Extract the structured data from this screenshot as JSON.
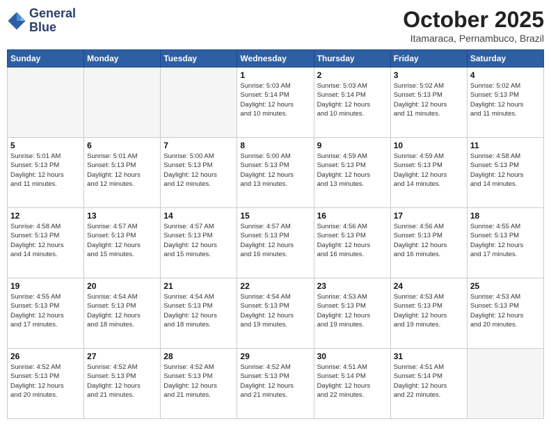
{
  "logo": {
    "line1": "General",
    "line2": "Blue"
  },
  "title": "October 2025",
  "location": "Itamaraca, Pernambuco, Brazil",
  "days_header": [
    "Sunday",
    "Monday",
    "Tuesday",
    "Wednesday",
    "Thursday",
    "Friday",
    "Saturday"
  ],
  "weeks": [
    [
      {
        "day": "",
        "info": ""
      },
      {
        "day": "",
        "info": ""
      },
      {
        "day": "",
        "info": ""
      },
      {
        "day": "1",
        "info": "Sunrise: 5:03 AM\nSunset: 5:14 PM\nDaylight: 12 hours\nand 10 minutes."
      },
      {
        "day": "2",
        "info": "Sunrise: 5:03 AM\nSunset: 5:14 PM\nDaylight: 12 hours\nand 10 minutes."
      },
      {
        "day": "3",
        "info": "Sunrise: 5:02 AM\nSunset: 5:13 PM\nDaylight: 12 hours\nand 11 minutes."
      },
      {
        "day": "4",
        "info": "Sunrise: 5:02 AM\nSunset: 5:13 PM\nDaylight: 12 hours\nand 11 minutes."
      }
    ],
    [
      {
        "day": "5",
        "info": "Sunrise: 5:01 AM\nSunset: 5:13 PM\nDaylight: 12 hours\nand 11 minutes."
      },
      {
        "day": "6",
        "info": "Sunrise: 5:01 AM\nSunset: 5:13 PM\nDaylight: 12 hours\nand 12 minutes."
      },
      {
        "day": "7",
        "info": "Sunrise: 5:00 AM\nSunset: 5:13 PM\nDaylight: 12 hours\nand 12 minutes."
      },
      {
        "day": "8",
        "info": "Sunrise: 5:00 AM\nSunset: 5:13 PM\nDaylight: 12 hours\nand 13 minutes."
      },
      {
        "day": "9",
        "info": "Sunrise: 4:59 AM\nSunset: 5:13 PM\nDaylight: 12 hours\nand 13 minutes."
      },
      {
        "day": "10",
        "info": "Sunrise: 4:59 AM\nSunset: 5:13 PM\nDaylight: 12 hours\nand 14 minutes."
      },
      {
        "day": "11",
        "info": "Sunrise: 4:58 AM\nSunset: 5:13 PM\nDaylight: 12 hours\nand 14 minutes."
      }
    ],
    [
      {
        "day": "12",
        "info": "Sunrise: 4:58 AM\nSunset: 5:13 PM\nDaylight: 12 hours\nand 14 minutes."
      },
      {
        "day": "13",
        "info": "Sunrise: 4:57 AM\nSunset: 5:13 PM\nDaylight: 12 hours\nand 15 minutes."
      },
      {
        "day": "14",
        "info": "Sunrise: 4:57 AM\nSunset: 5:13 PM\nDaylight: 12 hours\nand 15 minutes."
      },
      {
        "day": "15",
        "info": "Sunrise: 4:57 AM\nSunset: 5:13 PM\nDaylight: 12 hours\nand 16 minutes."
      },
      {
        "day": "16",
        "info": "Sunrise: 4:56 AM\nSunset: 5:13 PM\nDaylight: 12 hours\nand 16 minutes."
      },
      {
        "day": "17",
        "info": "Sunrise: 4:56 AM\nSunset: 5:13 PM\nDaylight: 12 hours\nand 16 minutes."
      },
      {
        "day": "18",
        "info": "Sunrise: 4:55 AM\nSunset: 5:13 PM\nDaylight: 12 hours\nand 17 minutes."
      }
    ],
    [
      {
        "day": "19",
        "info": "Sunrise: 4:55 AM\nSunset: 5:13 PM\nDaylight: 12 hours\nand 17 minutes."
      },
      {
        "day": "20",
        "info": "Sunrise: 4:54 AM\nSunset: 5:13 PM\nDaylight: 12 hours\nand 18 minutes."
      },
      {
        "day": "21",
        "info": "Sunrise: 4:54 AM\nSunset: 5:13 PM\nDaylight: 12 hours\nand 18 minutes."
      },
      {
        "day": "22",
        "info": "Sunrise: 4:54 AM\nSunset: 5:13 PM\nDaylight: 12 hours\nand 19 minutes."
      },
      {
        "day": "23",
        "info": "Sunrise: 4:53 AM\nSunset: 5:13 PM\nDaylight: 12 hours\nand 19 minutes."
      },
      {
        "day": "24",
        "info": "Sunrise: 4:53 AM\nSunset: 5:13 PM\nDaylight: 12 hours\nand 19 minutes."
      },
      {
        "day": "25",
        "info": "Sunrise: 4:53 AM\nSunset: 5:13 PM\nDaylight: 12 hours\nand 20 minutes."
      }
    ],
    [
      {
        "day": "26",
        "info": "Sunrise: 4:52 AM\nSunset: 5:13 PM\nDaylight: 12 hours\nand 20 minutes."
      },
      {
        "day": "27",
        "info": "Sunrise: 4:52 AM\nSunset: 5:13 PM\nDaylight: 12 hours\nand 21 minutes."
      },
      {
        "day": "28",
        "info": "Sunrise: 4:52 AM\nSunset: 5:13 PM\nDaylight: 12 hours\nand 21 minutes."
      },
      {
        "day": "29",
        "info": "Sunrise: 4:52 AM\nSunset: 5:13 PM\nDaylight: 12 hours\nand 21 minutes."
      },
      {
        "day": "30",
        "info": "Sunrise: 4:51 AM\nSunset: 5:14 PM\nDaylight: 12 hours\nand 22 minutes."
      },
      {
        "day": "31",
        "info": "Sunrise: 4:51 AM\nSunset: 5:14 PM\nDaylight: 12 hours\nand 22 minutes."
      },
      {
        "day": "",
        "info": ""
      }
    ]
  ]
}
